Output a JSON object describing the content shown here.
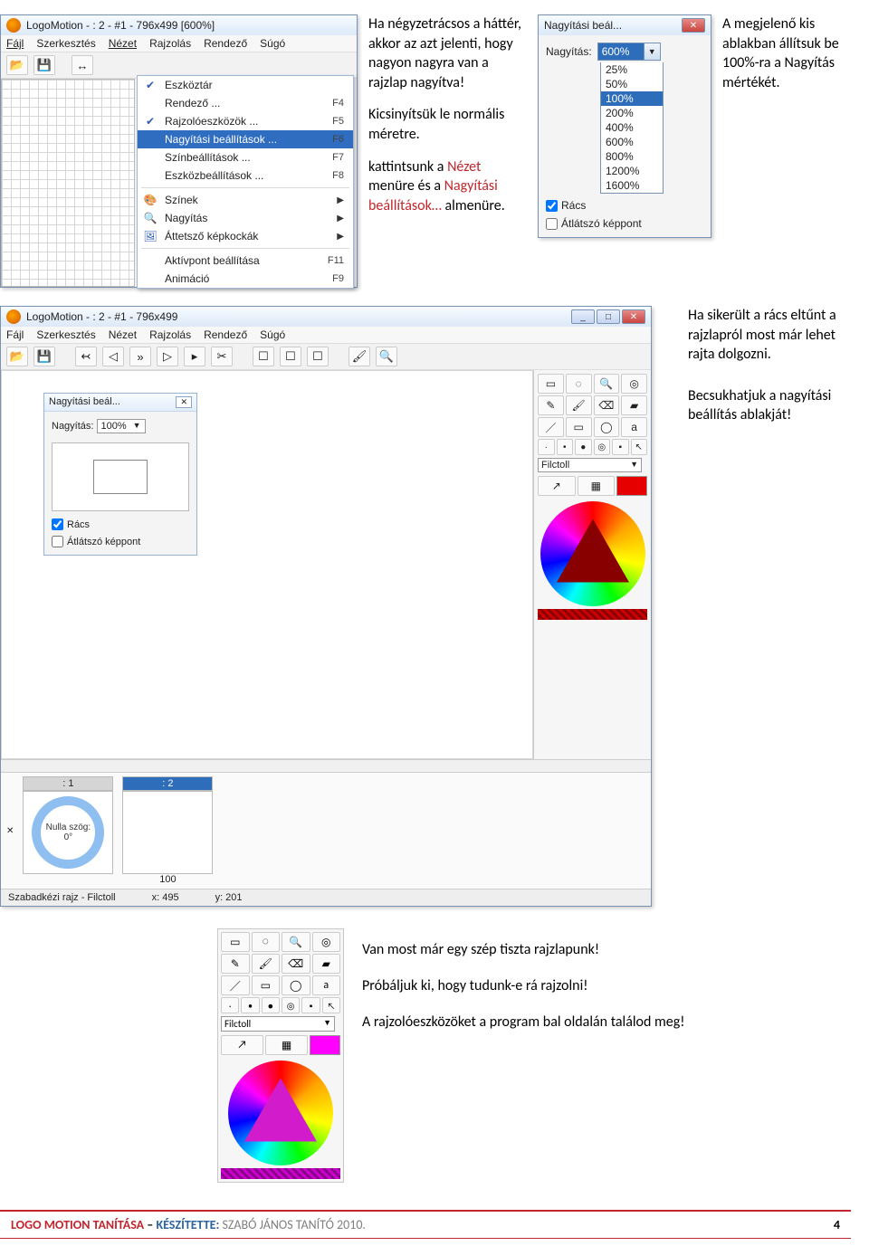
{
  "screenshots": {
    "menu_window": {
      "title": "LogoMotion - : 2 - #1 - 796x499 [600%]",
      "menubar": [
        "Fájl",
        "Szerkesztés",
        "Nézet",
        "Rajzolás",
        "Rendező",
        "Súgó"
      ],
      "dropdown_items": [
        {
          "check": true,
          "label": "Eszköztár",
          "shortcut": "",
          "arrow": false
        },
        {
          "check": false,
          "label": "Rendező ...",
          "shortcut": "F4",
          "arrow": false
        },
        {
          "check": true,
          "label": "Rajzolóeszközök ...",
          "shortcut": "F5",
          "arrow": false
        },
        {
          "check": false,
          "label": "Nagyítási beállítások ...",
          "shortcut": "F6",
          "arrow": false,
          "selected": true
        },
        {
          "check": false,
          "label": "Színbeállítások ...",
          "shortcut": "F7",
          "arrow": false
        },
        {
          "check": false,
          "label": "Eszközbeállítások ...",
          "shortcut": "F8",
          "arrow": false
        },
        {
          "sep": true
        },
        {
          "check": false,
          "label": "Színek",
          "shortcut": "",
          "arrow": true,
          "icon": "palette"
        },
        {
          "check": false,
          "label": "Nagyítás",
          "shortcut": "",
          "arrow": true,
          "icon": "zoom"
        },
        {
          "check": false,
          "label": "Áttetsző képkockák",
          "shortcut": "",
          "arrow": true,
          "icon": "frames"
        },
        {
          "sep": true
        },
        {
          "check": false,
          "label": "Aktívpont beállítása",
          "shortcut": "F11",
          "arrow": false
        },
        {
          "check": false,
          "label": "Animáció",
          "shortcut": "F9",
          "arrow": false
        }
      ]
    },
    "text_col1": {
      "p1": "Ha négyzetrácsos a háttér, akkor az azt jelenti, hogy nagyon nagyra van a rajzlap nagyítva!",
      "p2": "Kicsinyítsük le normális méretre.",
      "p3_pre": "kattintsunk a ",
      "p3_red1": "Nézet",
      "p3_mid": " menüre és a ",
      "p3_red2": "Nagyítási beállítások…",
      "p3_post": " almenüre."
    },
    "zoom_dialog": {
      "title": "Nagyítási beál...",
      "label": "Nagyítás:",
      "selected": "600%",
      "options": [
        "25%",
        "50%",
        "100%",
        "200%",
        "400%",
        "600%",
        "800%",
        "1200%",
        "1600%"
      ],
      "highlight": "100%",
      "chk_rács": "Rács",
      "chk_atlatszo": "Átlátszó képpont"
    },
    "text_col_right": {
      "p": "A megjelenő kis ablakban állítsuk be 100%-ra  a Nagyítás mértékét."
    },
    "big_window": {
      "title": "LogoMotion - : 2 - #1 - 796x499",
      "menubar": [
        "Fájl",
        "Szerkesztés",
        "Nézet",
        "Rajzolás",
        "Rendező",
        "Súgó"
      ],
      "inner_dialog": {
        "title": "Nagyítási beál...",
        "label": "Nagyítás:",
        "value": "100%",
        "chk_rács": "Rács",
        "chk_atlatszo": "Átlátszó képpont"
      },
      "tool_dropdown": "Filctoll",
      "frames": {
        "first_header": ": 1",
        "second_header": ": 2",
        "ring_text": "Nulla szög:\n0°",
        "time": "100"
      },
      "status": {
        "left": "Szabadkézi rajz - Filctoll",
        "x": "x: 495",
        "y": "y: 201"
      }
    },
    "side_text": {
      "p1": "Ha sikerült a rács eltűnt a rajzlapról most már lehet rajta dolgozni.",
      "p2": "Becsukhatjuk a nagyítási beállítás ablakját!"
    },
    "bottom_palette": {
      "tool_dropdown": "Filctoll"
    },
    "bottom_text": {
      "p1": "Van most már egy szép tiszta rajzlapunk!",
      "p2": "Próbáljuk ki, hogy tudunk-e rá rajzolni!",
      "p3": "A rajzolóeszközöket a program bal oldalán találod meg!"
    }
  },
  "footer": {
    "red": "LOGO MOTION TANÍTÁSA",
    "sep": " – ",
    "blue": "KÉSZÍTETTE:",
    "grey": " SZABÓ JÁNOS TANÍTÓ 2010.",
    "page": "4"
  }
}
